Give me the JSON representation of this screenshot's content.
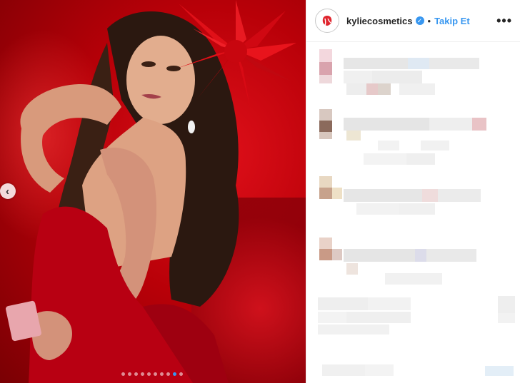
{
  "post": {
    "username": "kyliecosmetics",
    "verified_icon": "verified-badge-icon",
    "separator": "•",
    "follow_label": "Takip Et",
    "more_icon": "more-options-icon",
    "more_label": "•••"
  },
  "carousel": {
    "prev_icon": "chevron-left-icon",
    "prev_label": "‹",
    "slide_count": 10,
    "active_index": 8
  },
  "colors": {
    "accent": "#3897f0",
    "photo_red": "#c4000c",
    "text": "#262626"
  }
}
